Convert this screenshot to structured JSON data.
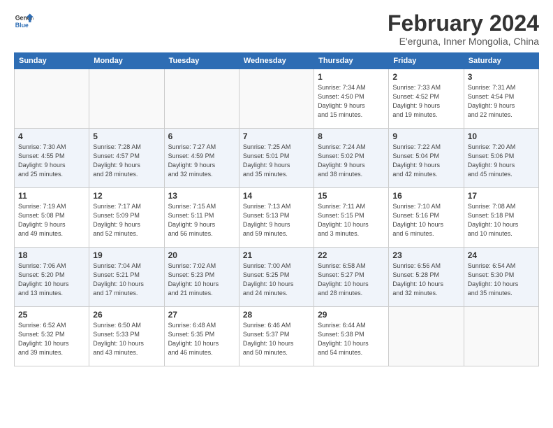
{
  "logo": {
    "line1": "General",
    "line2": "Blue"
  },
  "title": "February 2024",
  "subtitle": "E'erguna, Inner Mongolia, China",
  "days_of_week": [
    "Sunday",
    "Monday",
    "Tuesday",
    "Wednesday",
    "Thursday",
    "Friday",
    "Saturday"
  ],
  "weeks": [
    [
      {
        "day": "",
        "info": ""
      },
      {
        "day": "",
        "info": ""
      },
      {
        "day": "",
        "info": ""
      },
      {
        "day": "",
        "info": ""
      },
      {
        "day": "1",
        "info": "Sunrise: 7:34 AM\nSunset: 4:50 PM\nDaylight: 9 hours\nand 15 minutes."
      },
      {
        "day": "2",
        "info": "Sunrise: 7:33 AM\nSunset: 4:52 PM\nDaylight: 9 hours\nand 19 minutes."
      },
      {
        "day": "3",
        "info": "Sunrise: 7:31 AM\nSunset: 4:54 PM\nDaylight: 9 hours\nand 22 minutes."
      }
    ],
    [
      {
        "day": "4",
        "info": "Sunrise: 7:30 AM\nSunset: 4:55 PM\nDaylight: 9 hours\nand 25 minutes."
      },
      {
        "day": "5",
        "info": "Sunrise: 7:28 AM\nSunset: 4:57 PM\nDaylight: 9 hours\nand 28 minutes."
      },
      {
        "day": "6",
        "info": "Sunrise: 7:27 AM\nSunset: 4:59 PM\nDaylight: 9 hours\nand 32 minutes."
      },
      {
        "day": "7",
        "info": "Sunrise: 7:25 AM\nSunset: 5:01 PM\nDaylight: 9 hours\nand 35 minutes."
      },
      {
        "day": "8",
        "info": "Sunrise: 7:24 AM\nSunset: 5:02 PM\nDaylight: 9 hours\nand 38 minutes."
      },
      {
        "day": "9",
        "info": "Sunrise: 7:22 AM\nSunset: 5:04 PM\nDaylight: 9 hours\nand 42 minutes."
      },
      {
        "day": "10",
        "info": "Sunrise: 7:20 AM\nSunset: 5:06 PM\nDaylight: 9 hours\nand 45 minutes."
      }
    ],
    [
      {
        "day": "11",
        "info": "Sunrise: 7:19 AM\nSunset: 5:08 PM\nDaylight: 9 hours\nand 49 minutes."
      },
      {
        "day": "12",
        "info": "Sunrise: 7:17 AM\nSunset: 5:09 PM\nDaylight: 9 hours\nand 52 minutes."
      },
      {
        "day": "13",
        "info": "Sunrise: 7:15 AM\nSunset: 5:11 PM\nDaylight: 9 hours\nand 56 minutes."
      },
      {
        "day": "14",
        "info": "Sunrise: 7:13 AM\nSunset: 5:13 PM\nDaylight: 9 hours\nand 59 minutes."
      },
      {
        "day": "15",
        "info": "Sunrise: 7:11 AM\nSunset: 5:15 PM\nDaylight: 10 hours\nand 3 minutes."
      },
      {
        "day": "16",
        "info": "Sunrise: 7:10 AM\nSunset: 5:16 PM\nDaylight: 10 hours\nand 6 minutes."
      },
      {
        "day": "17",
        "info": "Sunrise: 7:08 AM\nSunset: 5:18 PM\nDaylight: 10 hours\nand 10 minutes."
      }
    ],
    [
      {
        "day": "18",
        "info": "Sunrise: 7:06 AM\nSunset: 5:20 PM\nDaylight: 10 hours\nand 13 minutes."
      },
      {
        "day": "19",
        "info": "Sunrise: 7:04 AM\nSunset: 5:21 PM\nDaylight: 10 hours\nand 17 minutes."
      },
      {
        "day": "20",
        "info": "Sunrise: 7:02 AM\nSunset: 5:23 PM\nDaylight: 10 hours\nand 21 minutes."
      },
      {
        "day": "21",
        "info": "Sunrise: 7:00 AM\nSunset: 5:25 PM\nDaylight: 10 hours\nand 24 minutes."
      },
      {
        "day": "22",
        "info": "Sunrise: 6:58 AM\nSunset: 5:27 PM\nDaylight: 10 hours\nand 28 minutes."
      },
      {
        "day": "23",
        "info": "Sunrise: 6:56 AM\nSunset: 5:28 PM\nDaylight: 10 hours\nand 32 minutes."
      },
      {
        "day": "24",
        "info": "Sunrise: 6:54 AM\nSunset: 5:30 PM\nDaylight: 10 hours\nand 35 minutes."
      }
    ],
    [
      {
        "day": "25",
        "info": "Sunrise: 6:52 AM\nSunset: 5:32 PM\nDaylight: 10 hours\nand 39 minutes."
      },
      {
        "day": "26",
        "info": "Sunrise: 6:50 AM\nSunset: 5:33 PM\nDaylight: 10 hours\nand 43 minutes."
      },
      {
        "day": "27",
        "info": "Sunrise: 6:48 AM\nSunset: 5:35 PM\nDaylight: 10 hours\nand 46 minutes."
      },
      {
        "day": "28",
        "info": "Sunrise: 6:46 AM\nSunset: 5:37 PM\nDaylight: 10 hours\nand 50 minutes."
      },
      {
        "day": "29",
        "info": "Sunrise: 6:44 AM\nSunset: 5:38 PM\nDaylight: 10 hours\nand 54 minutes."
      },
      {
        "day": "",
        "info": ""
      },
      {
        "day": "",
        "info": ""
      }
    ]
  ]
}
